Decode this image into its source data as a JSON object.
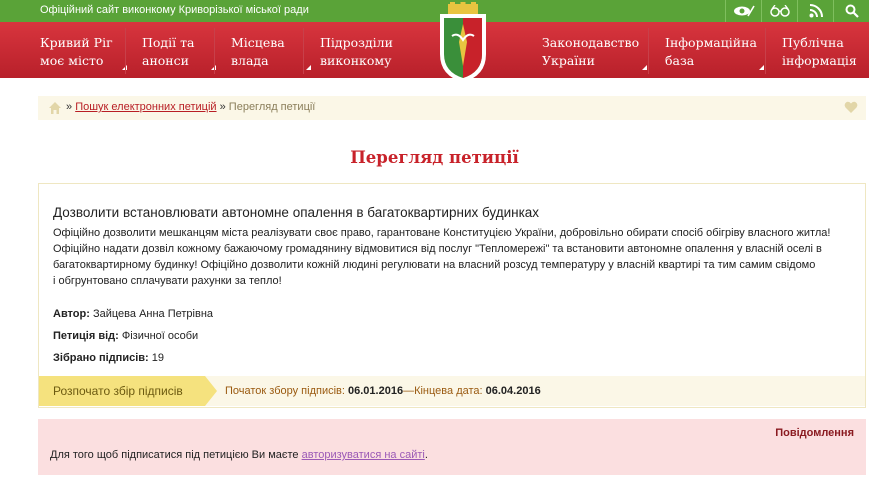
{
  "topbar": {
    "site_title": "Офіційний сайт виконкому Криворізької міської ради",
    "icons": [
      "low-vision-icon",
      "glasses-icon",
      "rss-icon",
      "search-icon"
    ]
  },
  "nav": {
    "items": [
      {
        "line1": "Кривий Ріг",
        "line2": "моє місто"
      },
      {
        "line1": "Події та",
        "line2": "анонси"
      },
      {
        "line1": "Місцева",
        "line2": "влада"
      },
      {
        "line1": "Підрозділи",
        "line2": "виконкому"
      },
      {
        "line1": "Законодавство",
        "line2": "України"
      },
      {
        "line1": "Інформаційна",
        "line2": "база"
      },
      {
        "line1": "Публічна",
        "line2": "інформація"
      }
    ]
  },
  "breadcrumb": {
    "sep1": "»",
    "link": "Пошук електронних петицій",
    "sep2": "»",
    "current": "Перегляд петиції"
  },
  "page_title": "Перегляд петиції",
  "petition": {
    "title": "Дозволити встановлювати автономне опалення в багатоквартирних будинках",
    "lines": [
      "Офіційно дозволити мешканцям міста реалізувати своє право, гарантоване Конституцією України, добровільно обирати спосіб обігріву власного житла!",
      "Офіційно надати дозвіл кожному бажаючому громадянину відмовитися від послуг \"Тепломережі\" та встановити автономне опалення у власній оселі в",
      "багатоквартирному будинку! Офіційно дозволити кожній людині регулювати на власний розсуд температуру у власній квартирі та тим самим свідомо",
      "і обгрунтовано сплачувати рахунки за тепло!"
    ],
    "author_label": "Автор:",
    "author": "Зайцева Анна Петрівна",
    "from_label": "Петиція від:",
    "from": "Фізичної особи",
    "signatures_label": "Зібрано підписів:",
    "signatures": "19",
    "status": "Розпочато збір підписів",
    "start_label": "Початок збору підписів:",
    "start_date": "06.01.2016",
    "dash": "—",
    "end_label": "Кінцева дата:",
    "end_date": "06.04.2016"
  },
  "notice": {
    "title": "Повідомлення",
    "text": "Для того щоб підписатися під петицією Ви маєте",
    "link": "авторизуватися на сайті",
    "dot": "."
  },
  "colors": {
    "topbar": "#5aa338",
    "nav": "#c8222a",
    "title": "#c8222a",
    "status": "#f5e27e",
    "notice_bg": "#fbdfe0"
  }
}
